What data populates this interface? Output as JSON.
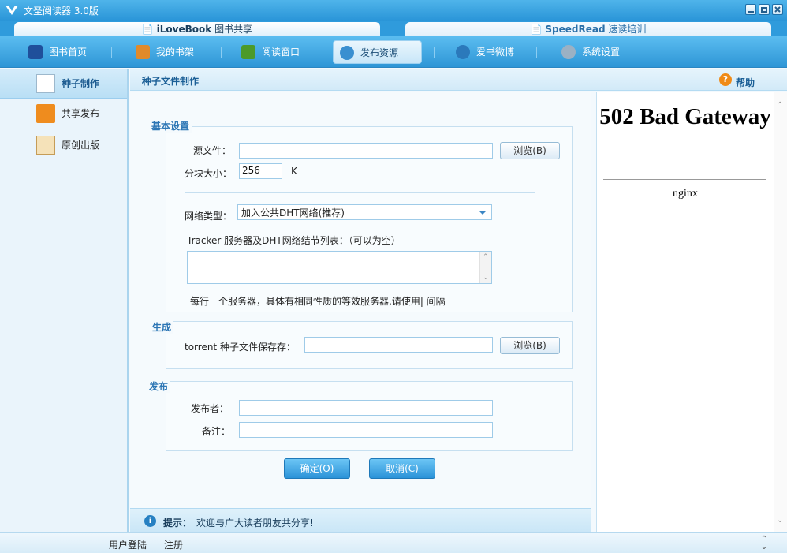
{
  "window": {
    "title": "文圣阅读器 3.0版"
  },
  "top_tabs": [
    {
      "label": "iLoveBook 图书共享",
      "bold": "iLoveBook",
      "rest": " 图书共享"
    },
    {
      "label": "SpeedRead 速读培训",
      "bold": "SpeedRead",
      "rest": " 速读培训"
    }
  ],
  "nav": {
    "items": [
      {
        "label": "图书首页"
      },
      {
        "label": "我的书架"
      },
      {
        "label": "阅读窗口"
      },
      {
        "label": "发布资源"
      },
      {
        "label": "爱书微博"
      },
      {
        "label": "系统设置"
      }
    ],
    "active_index": 3
  },
  "sidebar": {
    "items": [
      {
        "label": "种子制作"
      },
      {
        "label": "共享发布"
      },
      {
        "label": "原创出版"
      }
    ],
    "active_index": 0
  },
  "content": {
    "title": "种子文件制作",
    "help": "帮助"
  },
  "basic": {
    "legend": "基本设置",
    "source_label": "源文件：",
    "source_value": "",
    "browse1": "浏览(B)",
    "block_label": "分块大小：",
    "block_value": "256",
    "block_unit": "K",
    "network_label": "网络类型：",
    "network_value": "加入公共DHT网络(推荐)",
    "tracker_label": "Tracker 服务器及DHT网络结节列表：（可以为空）",
    "tracker_hint": "每行一个服务器，具体有相同性质的等效服务器,请使用| 间隔"
  },
  "generate": {
    "legend": "生成",
    "save_label": "torrent 种子文件保存存：",
    "save_value": "",
    "browse2": "浏览(B)"
  },
  "publish": {
    "legend": "发布",
    "publisher_label": "发布者：",
    "publisher_value": "",
    "note_label": "备注：",
    "note_value": ""
  },
  "actions": {
    "ok": "确定(O)",
    "cancel": "取消(C)"
  },
  "tip": {
    "label": "提示：",
    "text": "欢迎与广大读者朋友共分享!"
  },
  "right_panel": {
    "title": "502 Bad Gateway",
    "footer": "nginx"
  },
  "status": {
    "login": "用户登陆",
    "register": "注册"
  },
  "colors": {
    "accent": "#2e96d6",
    "legend": "#2d76b5",
    "primary_button": "#2b93d8"
  }
}
